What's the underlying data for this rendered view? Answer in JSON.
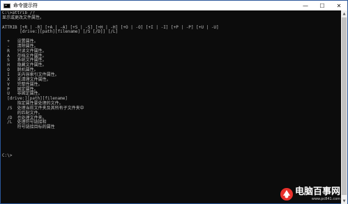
{
  "window": {
    "title": "命令提示符",
    "minimize_glyph": "—",
    "maximize_glyph": "☐",
    "close_glyph": "✕"
  },
  "console": {
    "lines": [
      "C:\\>attrib /?",
      "显示或更改文件属性。",
      "",
      "ATTRIB [+R | -R] [+A | -A] [+S | -S] [+H | -H] [+O | -O] [+I | -I] [+P | -P] [+U | -U]",
      "       [drive:][path][filename] [/S [/D]] [/L]",
      "",
      "  +   设置属性。",
      "  -   清除属性。",
      "  R   只读文件属性。",
      "  A   存档文件属性。",
      "  S   系统文件属性。",
      "  H   隐藏文件属性。",
      "  O   脱机属性。",
      "  I   无内容索引文件属性。",
      "  X   无清理文件属性。",
      "  V   完整性属性。",
      "  P   固定属性。",
      "  U   非固定属性。",
      "  [drive:][path][filename]",
      "      指定属性要处理的文件。",
      "  /S  处理当前文件夹及其所有子文件夹中",
      "      的匹配文件。",
      "  /D  也处理文件夹。",
      "  /L  处理符号链接和",
      "      符号链接目标的属性",
      "",
      "",
      "",
      "",
      "",
      "C:\\>"
    ]
  },
  "scrollbar": {
    "up_glyph": "▲",
    "down_glyph": "▼"
  },
  "watermark": {
    "title": "电脑百事网",
    "url": "www.pc841.com"
  },
  "colors": {
    "console_background": "#0c0c0c",
    "console_text": "#c0c0c0",
    "titlebar": "#ffffff",
    "watermark_accent": "#e8312c"
  }
}
